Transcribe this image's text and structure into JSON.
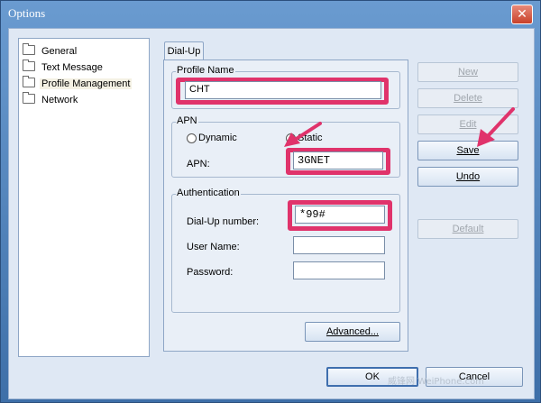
{
  "window": {
    "title": "Options",
    "close_glyph": "✕"
  },
  "sidebar": {
    "items": [
      {
        "label": "General"
      },
      {
        "label": "Text Message"
      },
      {
        "label": "Profile Management"
      },
      {
        "label": "Network"
      }
    ]
  },
  "tab": {
    "label": "Dial-Up"
  },
  "profile": {
    "group_label": "Profile Name",
    "value": "CHT"
  },
  "apn": {
    "group_label": "APN",
    "dynamic_label": "Dynamic",
    "static_label": "Static",
    "selected": "Static",
    "field_label": "APN:",
    "value": "3GNET"
  },
  "auth": {
    "group_label": "Authentication",
    "dialup_label": "Dial-Up number:",
    "dialup_value": "*99#",
    "username_label": "User Name:",
    "username_value": "",
    "password_label": "Password:",
    "password_value": ""
  },
  "buttons": {
    "new": "New",
    "delete": "Delete",
    "edit": "Edit",
    "save": "Save",
    "undo": "Undo",
    "default": "Default",
    "advanced": "Advanced...",
    "ok": "OK",
    "cancel": "Cancel"
  },
  "watermark": "威锋网 WeiPhone.com",
  "colors": {
    "highlight": "#e0336b",
    "title_bar": "#4a7db8"
  }
}
